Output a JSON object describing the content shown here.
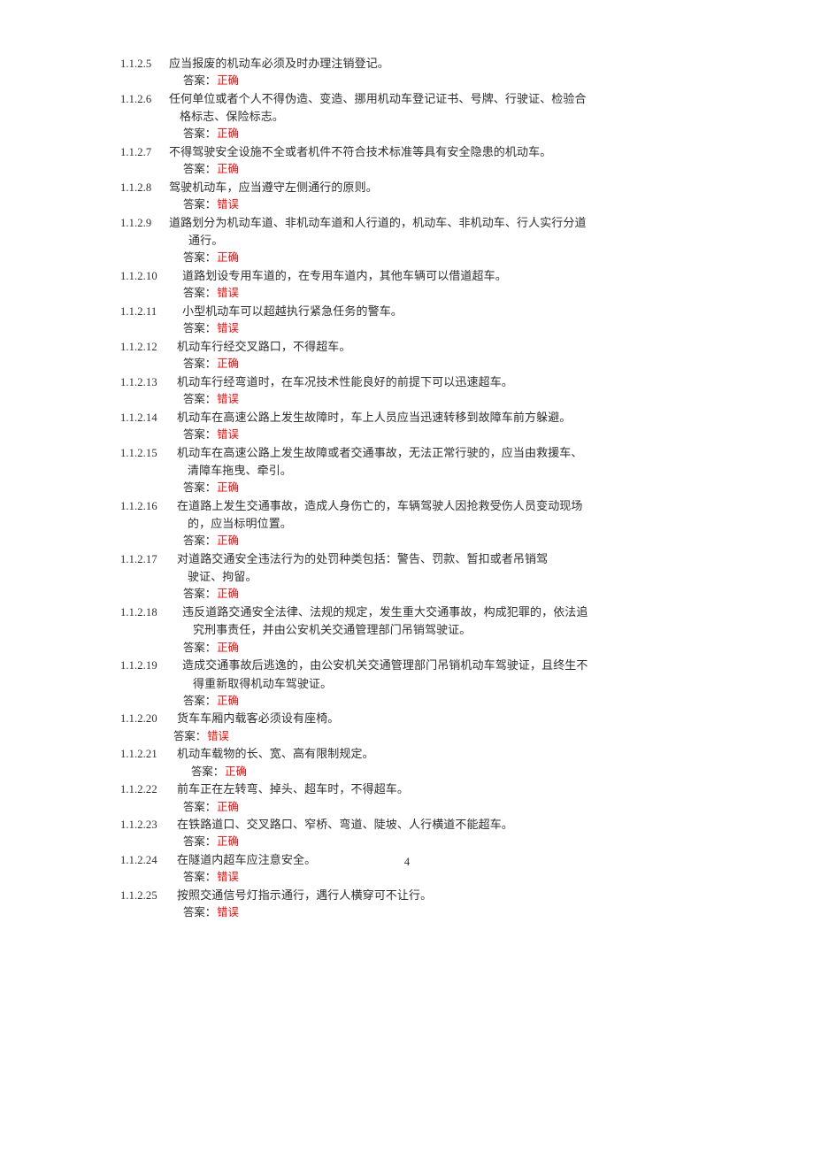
{
  "document": {
    "page_number": "4",
    "answer_label": "答案：",
    "answer_colors": {
      "correct": "#fb0606",
      "wrong": "#fb0606",
      "body_text": "#2e2e2e"
    }
  },
  "items": [
    {
      "number": "1.1.2.5",
      "lines": [
        "应当报废的机动车必须及时办理注销登记。"
      ],
      "answer": "正确"
    },
    {
      "number": "1.1.2.6",
      "lines": [
        "任何单位或者个人不得伪造、变造、挪用机动车登记证书、号牌、行驶证、检验合",
        "格标志、保险标志。"
      ],
      "answer": "正确"
    },
    {
      "number": "1.1.2.7",
      "lines": [
        "不得驾驶安全设施不全或者机件不符合技术标准等具有安全隐患的机动车。"
      ],
      "answer": "正确"
    },
    {
      "number": "1.1.2.8",
      "lines": [
        "驾驶机动车，应当遵守左侧通行的原则。"
      ],
      "answer": "错误"
    },
    {
      "number": "1.1.2.9",
      "lines": [
        "道路划分为机动车道、非机动车道和人行道的，机动车、非机动车、行人实行分道",
        "通行。"
      ],
      "answer": "正确"
    },
    {
      "number": "1.1.2.10",
      "lines": [
        "道路划设专用车道的，在专用车道内，其他车辆可以借道超车。"
      ],
      "answer": "错误"
    },
    {
      "number": "1.1.2.11",
      "lines": [
        "小型机动车可以超越执行紧急任务的警车。"
      ],
      "answer": "错误"
    },
    {
      "number": "1.1.2.12",
      "lines": [
        "机动车行经交叉路口，不得超车。"
      ],
      "answer": "正确"
    },
    {
      "number": "1.1.2.13",
      "lines": [
        "机动车行经弯道时，在车况技术性能良好的前提下可以迅速超车。"
      ],
      "answer": "错误"
    },
    {
      "number": "1.1.2.14",
      "lines": [
        "机动车在高速公路上发生故障时，车上人员应当迅速转移到故障车前方躲避。"
      ],
      "answer": "错误"
    },
    {
      "number": "1.1.2.15",
      "lines": [
        "机动车在高速公路上发生故障或者交通事故，无法正常行驶的，应当由救援车、",
        "清障车拖曳、牵引。"
      ],
      "answer": "正确"
    },
    {
      "number": "1.1.2.16",
      "lines": [
        "在道路上发生交通事故，造成人身伤亡的，车辆驾驶人因抢救受伤人员变动现场",
        "的，应当标明位置。"
      ],
      "answer": "正确"
    },
    {
      "number": "1.1.2.17",
      "lines": [
        "对道路交通安全违法行为的处罚种类包括：警告、罚款、暂扣或者吊销驾",
        "驶证、拘留。"
      ],
      "answer": "正确"
    },
    {
      "number": "1.1.2.18",
      "lines": [
        "违反道路交通安全法律、法规的规定，发生重大交通事故，构成犯罪的，依法追",
        "究刑事责任，并由公安机关交通管理部门吊销驾驶证。"
      ],
      "answer": "正确"
    },
    {
      "number": "1.1.2.19",
      "lines": [
        "造成交通事故后逃逸的，由公安机关交通管理部门吊销机动车驾驶证，且终生不",
        "得重新取得机动车驾驶证。"
      ],
      "answer": "正确"
    },
    {
      "number": "1.1.2.20",
      "lines": [
        "货车车厢内载客必须设有座椅。"
      ],
      "answer": "错误"
    },
    {
      "number": "1.1.2.21",
      "lines": [
        "机动车载物的长、宽、高有限制规定。"
      ],
      "answer": "正确"
    },
    {
      "number": "1.1.2.22",
      "lines": [
        "前车正在左转弯、掉头、超车时，不得超车。"
      ],
      "answer": "正确"
    },
    {
      "number": "1.1.2.23",
      "lines": [
        "在铁路道口、交叉路口、窄桥、弯道、陡坡、人行横道不能超车。"
      ],
      "answer": "正确"
    },
    {
      "number": "1.1.2.24",
      "lines": [
        "在隧道内超车应注意安全。"
      ],
      "answer": "错误"
    },
    {
      "number": "1.1.2.25",
      "lines": [
        "按照交通信号灯指示通行，遇行人横穿可不让行。"
      ],
      "answer": "错误"
    }
  ]
}
